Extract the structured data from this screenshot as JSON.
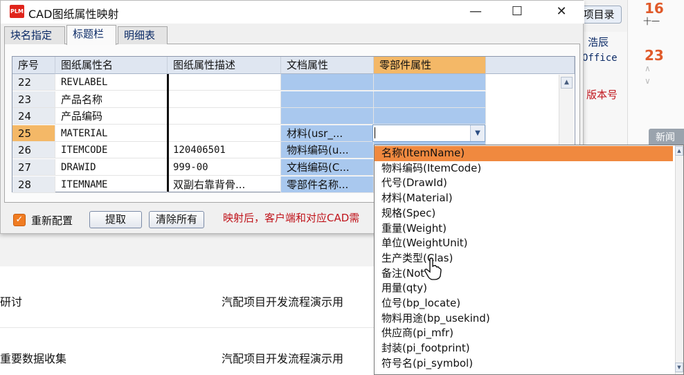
{
  "background": {
    "top_button": "项目录",
    "side_items": [
      "浩辰",
      "Office",
      "版本号"
    ],
    "calendar": {
      "num1": "16",
      "sub1": "十一",
      "num2": "23"
    },
    "news_button": "新闻",
    "list_rows": [
      {
        "left": "研讨",
        "right": "汽配项目开发流程演示用"
      },
      {
        "left": "重要数据收集",
        "right": "汽配项目开发流程演示用"
      }
    ]
  },
  "dialog": {
    "logo": "PLM",
    "title": "CAD图纸属性映射",
    "tabs": [
      "块名指定",
      "标题栏",
      "明细表"
    ],
    "active_tab": 1,
    "columns": [
      "序号",
      "图纸属性名",
      "图纸属性描述",
      "文档属性",
      "零部件属性"
    ],
    "rows": [
      {
        "no": "22",
        "name": "REVLABEL",
        "desc": "",
        "doc": "",
        "part": ""
      },
      {
        "no": "23",
        "name": "产品名称",
        "desc": "",
        "doc": "",
        "part": ""
      },
      {
        "no": "24",
        "name": "产品编码",
        "desc": "",
        "doc": "",
        "part": ""
      },
      {
        "no": "25",
        "name": "MATERIAL",
        "desc": "",
        "doc": "材料(usr_...",
        "part": ""
      },
      {
        "no": "26",
        "name": "ITEMCODE",
        "desc": "120406501",
        "doc": "物料编码(u...",
        "part": ""
      },
      {
        "no": "27",
        "name": "DRAWID",
        "desc": "999-00",
        "doc": "文档编码(C...",
        "part": ""
      },
      {
        "no": "28",
        "name": "ITEMNAME",
        "desc": "双副右靠背骨...",
        "doc": "零部件名称...",
        "part": ""
      }
    ],
    "current_row": 3,
    "reconfig_label": "重新配置",
    "reconfig_checked": true,
    "extract_button": "提取",
    "clear_button": "清除所有",
    "note": "映射后，客户端和对应CAD需"
  },
  "dropdown": {
    "highlighted": 0,
    "options": [
      "名称(ItemName)",
      "物料编码(ItemCode)",
      "代号(DrawId)",
      "材料(Material)",
      "规格(Spec)",
      "重量(Weight)",
      "单位(WeightUnit)",
      "生产类型(Clas)",
      "备注(Not",
      "用量(qty)",
      "位号(bp_locate)",
      "物料用途(bp_usekind)",
      "供应商(pi_mfr)",
      "封装(pi_footprint)",
      "符号名(pi_symbol)"
    ]
  },
  "colors": {
    "accent": "#f4b867",
    "highlight": "#f0893f",
    "blue_cell": "#a9c8ee",
    "note_red": "#c0141b"
  }
}
